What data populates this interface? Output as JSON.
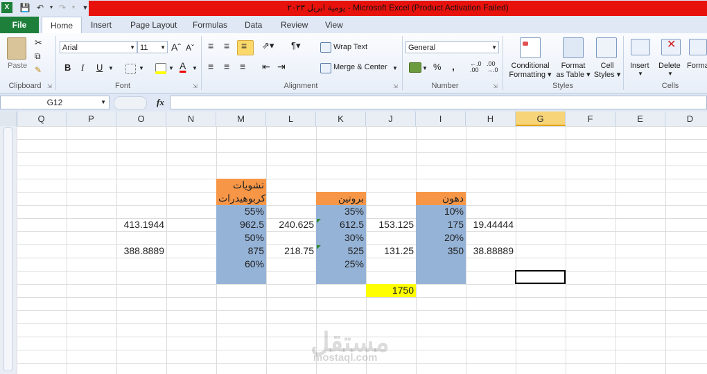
{
  "window": {
    "title": "يومية ابريل ٢٠٢٣  -  Microsoft Excel (Product Activation Failed)"
  },
  "ribbon_tabs": [
    "File",
    "Home",
    "Insert",
    "Page Layout",
    "Formulas",
    "Data",
    "Review",
    "View"
  ],
  "clipboard": {
    "paste": "Paste",
    "group_label": "Clipboard"
  },
  "font": {
    "name": "Arial",
    "size": "11",
    "bold": "B",
    "italic": "I",
    "underline": "U",
    "group_label": "Font"
  },
  "alignment": {
    "wrap_text": "Wrap Text",
    "merge_center": "Merge & Center",
    "group_label": "Alignment"
  },
  "number": {
    "format": "General",
    "percent": "%",
    "comma": ",",
    "group_label": "Number"
  },
  "styles": {
    "conditional": [
      "Conditional",
      "Formatting"
    ],
    "format_table": [
      "Format",
      "as Table"
    ],
    "cell_styles": [
      "Cell",
      "Styles"
    ],
    "group_label": "Styles"
  },
  "cells": {
    "insert": "Insert",
    "delete": "Delete",
    "format": "Forma",
    "group_label": "Cells"
  },
  "formula_bar": {
    "name_box": "G12",
    "fx": "fx",
    "value": ""
  },
  "columns": [
    "Q",
    "P",
    "O",
    "N",
    "M",
    "L",
    "K",
    "J",
    "I",
    "H",
    "G",
    "F",
    "E",
    "D"
  ],
  "selected_column": "G",
  "cells_data": {
    "M_header1": "تشويات",
    "M_header2": "كربوهيدرات",
    "K_header": "بروتين",
    "I_header": "دهون",
    "M_pct1": "55%",
    "K_pct1": "35%",
    "I_pct1": "10%",
    "O_r1": "413.1944",
    "M_r1": "962.5",
    "L_r1": "240.625",
    "K_r1": "612.5",
    "J_r1": "153.125",
    "I_r1": "175",
    "H_r1": "19.44444",
    "M_pct2": "50%",
    "K_pct2": "30%",
    "I_pct2": "20%",
    "O_r2": "388.8889",
    "M_r2": "875",
    "L_r2": "218.75",
    "K_r2": "525",
    "J_r2": "131.25",
    "I_r2": "350",
    "H_r2": "38.88889",
    "M_pct3": "60%",
    "K_pct3": "25%",
    "J_total": "1750"
  },
  "watermark": {
    "arabic": "مستقل",
    "latin": "mostaql.com"
  },
  "colors": {
    "header_orange": "#f79646",
    "data_blue": "#95b3d7",
    "total_yellow": "#ffff00",
    "title_red": "#e8120c",
    "file_green": "#1d7f3a"
  }
}
